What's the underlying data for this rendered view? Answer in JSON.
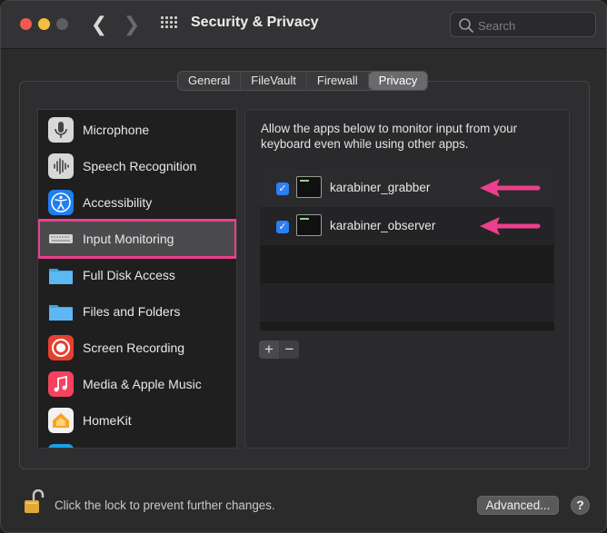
{
  "window": {
    "title": "Security & Privacy"
  },
  "search": {
    "placeholder": "Search"
  },
  "tabs": [
    {
      "label": "General"
    },
    {
      "label": "FileVault"
    },
    {
      "label": "Firewall"
    },
    {
      "label": "Privacy",
      "active": true
    }
  ],
  "sidebar": {
    "items": [
      {
        "label": "Microphone",
        "icon": "microphone-icon"
      },
      {
        "label": "Speech Recognition",
        "icon": "waveform-icon"
      },
      {
        "label": "Accessibility",
        "icon": "accessibility-icon"
      },
      {
        "label": "Input Monitoring",
        "icon": "keyboard-icon",
        "selected": true
      },
      {
        "label": "Full Disk Access",
        "icon": "folder-icon"
      },
      {
        "label": "Files and Folders",
        "icon": "folder-icon"
      },
      {
        "label": "Screen Recording",
        "icon": "screen-recording-icon"
      },
      {
        "label": "Media & Apple Music",
        "icon": "music-icon"
      },
      {
        "label": "HomeKit",
        "icon": "home-icon"
      }
    ]
  },
  "main": {
    "description": "Allow the apps below to monitor input from your keyboard even while using other apps.",
    "apps": [
      {
        "name": "karabiner_grabber",
        "checked": true,
        "icon": "terminal-icon"
      },
      {
        "name": "karabiner_observer",
        "checked": true,
        "icon": "terminal-icon"
      }
    ],
    "add_label": "+",
    "remove_label": "−"
  },
  "footer": {
    "lock_text": "Click the lock to prevent further changes.",
    "advanced_label": "Advanced...",
    "help_label": "?"
  },
  "colors": {
    "highlight": "#ec3f8d",
    "checkbox": "#2c7ff5",
    "arrow": "#ec3f8d"
  }
}
